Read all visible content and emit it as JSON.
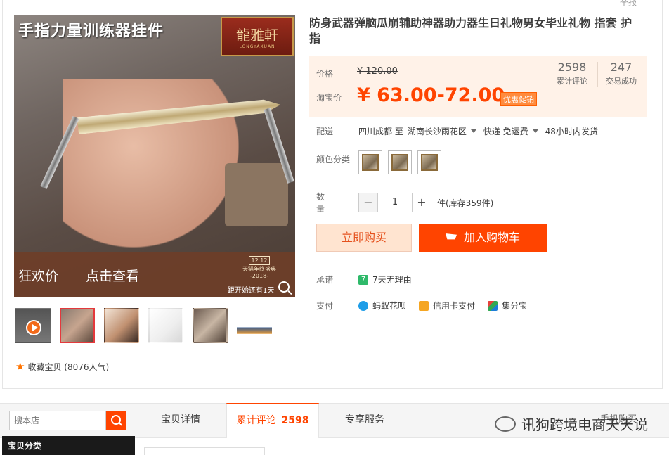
{
  "report_link": "举报",
  "gallery": {
    "main_caption": "手指力量训练器挂件",
    "logo_cn": "龍雅軒",
    "logo_en": "LONGYAXUAN",
    "banner": {
      "left": "狂欢价",
      "middle": "点击查看",
      "badge": "12.12",
      "event": "天猫年终盛典",
      "year": "-2018-",
      "countdown": "距开始还有1天"
    },
    "thumbnails": [
      "video",
      "image-1",
      "image-2",
      "image-3",
      "image-4",
      "image-5"
    ],
    "favorite": "收藏宝贝 (8076人气)"
  },
  "product": {
    "title": "防身武器弹脑瓜崩辅助神器助力器生日礼物男女毕业礼物 指套 护指",
    "price_label": "价格",
    "original_price": "¥ 120.00",
    "taobao_price_label": "淘宝价",
    "taobao_price": "¥ 63.00-72.00",
    "promo_tag": "优惠促销",
    "reviews_count": "2598",
    "reviews_label": "累计评论",
    "sales_count": "247",
    "sales_label": "交易成功"
  },
  "shipping": {
    "label": "配送",
    "from": "四川成都 至",
    "to": "湖南长沙雨花区",
    "method": "快递 免运费",
    "dispatch": "48小时内发货"
  },
  "color": {
    "label": "颜色分类",
    "option_count": 3
  },
  "quantity": {
    "label": "数量",
    "minus": "−",
    "value": "1",
    "plus": "+",
    "stock": "件(库存359件)"
  },
  "actions": {
    "buy_now": "立即购买",
    "add_to_cart": "加入购物车"
  },
  "promise": {
    "label": "承诺",
    "badge": "7",
    "text": "7天无理由"
  },
  "payment": {
    "label": "支付",
    "methods": [
      "蚂蚁花呗",
      "信用卡支付",
      "集分宝"
    ]
  },
  "tabs_bar": {
    "search_placeholder": "搜本店",
    "tabs": [
      "宝贝详情",
      "累计评论",
      "专享服务"
    ],
    "review_count": "2598",
    "trailing": "手机购买",
    "watermark": "讯狗跨境电商天天说"
  },
  "sidebar": {
    "category_title": "宝贝分类"
  },
  "colors": {
    "accent": "#ff4400",
    "price_bg": "#fff2e8",
    "buy_bg": "#ffe4d0"
  }
}
